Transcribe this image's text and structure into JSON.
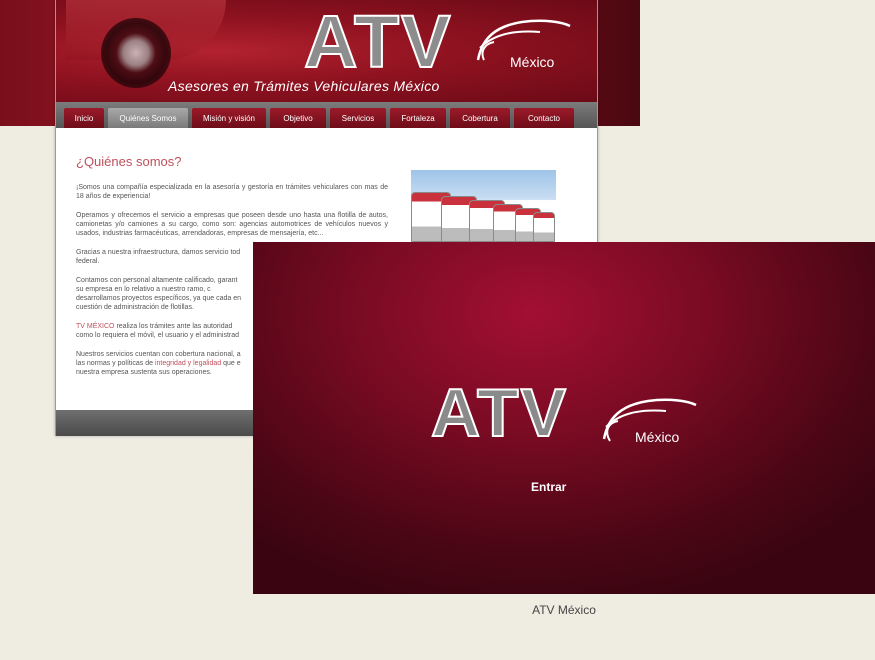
{
  "site": {
    "logo": {
      "text": "ATV",
      "sub": "México"
    },
    "tagline": "Asesores en Trámites Vehiculares México",
    "nav": [
      "Inicio",
      "Quiénes Somos",
      "Misión y visión",
      "Objetivo",
      "Servicios",
      "Fortaleza",
      "Cobertura",
      "Contacto"
    ],
    "nav_active": "Quiénes Somos",
    "content": {
      "heading": "¿Quiénes somos?",
      "p1": "¡Somos una compañía especializada en la asesoría y gestoría en trámites vehiculares con mas de 18 años de experiencia!",
      "p2": "Operamos y ofrecemos el servicio a empresas que poseen desde uno hasta una flotilla de autos, camionetas y/o camiones a su cargo, como son: agencias automotrices de vehículos nuevos y usados, industrias farmacéuticas, arrendadoras, empresas de mensajería, etc...",
      "p3": "Gracias a nuestra infraestructura, damos servicio tod",
      "p3b": "federal.",
      "p4a": "Contamos con personal altamente calificado, garant",
      "p4b": "su empresa en lo relativo a nuestro ramo, c",
      "p4c": "desarrollamos proyectos específicos, ya que cada en",
      "p4d": "cuestión de administración de flotillas.",
      "p5_link": "TV MÉXICO",
      "p5a": " realiza los trámites ante las autoridad",
      "p5b": "como lo requiera el móvil, el usuario y el administrad",
      "p6a": "Nuestros servicios cuentan con cobertura nacional, a",
      "p6b_pre": "las normas y políticas de ",
      "p6b_link": "integridad y legalidad",
      "p6b_post": " que e",
      "p6c": "nuestra empresa sustenta sus operaciones."
    }
  },
  "splash": {
    "logo": {
      "text": "ATV",
      "sub": "México"
    },
    "enter": "Entrar"
  },
  "caption": "ATV México",
  "colors": {
    "brand": "#8f1220",
    "splash": "#7a0b23",
    "accent_text": "#c0505c"
  }
}
